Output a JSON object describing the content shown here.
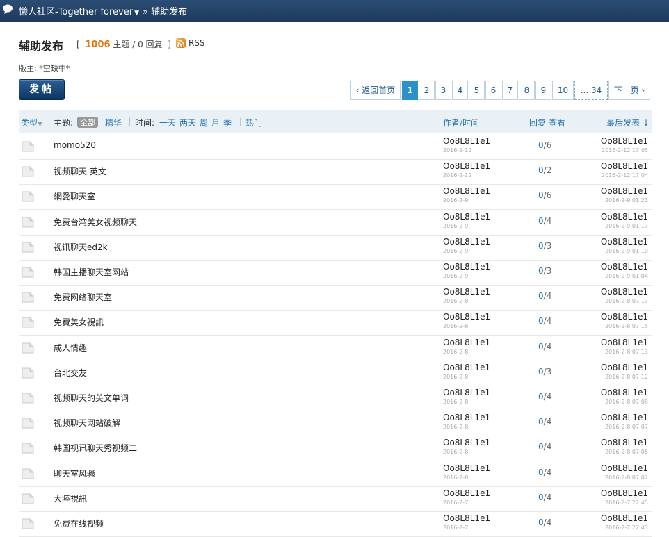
{
  "header": {
    "site_name": "懒人社区-Together forever",
    "breadcrumb": "» 辅助发布"
  },
  "forum": {
    "title": "辅助发布",
    "stats_open": "[",
    "topic_count": "1006",
    "topic_label": "主题",
    "sep": "/",
    "reply_count": "0",
    "reply_label": "回复",
    "stats_close": "]",
    "rss_label": "RSS",
    "moderator": "版主: *空缺中*"
  },
  "toolbar": {
    "post_label": "发帖"
  },
  "pager": {
    "back_label": "‹ 返回首页",
    "pages": [
      "1",
      "2",
      "3",
      "4",
      "5",
      "6",
      "7",
      "8",
      "9",
      "10"
    ],
    "current": "1",
    "last_label": "... 34",
    "next_label": "下一页 ›"
  },
  "thead": {
    "type_label": "类型",
    "topic_label": "主题:",
    "all_label": "全部",
    "digest_label": "精华",
    "time_label": "时间:",
    "day1": "一天",
    "day2": "两天",
    "week": "周",
    "month": "月",
    "season": "季",
    "hot_label": "热门",
    "author_label": "作者/时间",
    "reply_view_label": "回复 查看",
    "lastpost_label": "最后发表 ↓"
  },
  "threads": [
    {
      "title": "momo520",
      "author": "Oo8L8L1e1",
      "date": "2016-2-12",
      "replies": "0",
      "views": "6",
      "last_by": "Oo8L8L1e1",
      "last_time": "2016-2-12 17:05"
    },
    {
      "title": "视频聊天 英文",
      "author": "Oo8L8L1e1",
      "date": "2016-2-12",
      "replies": "0",
      "views": "2",
      "last_by": "Oo8L8L1e1",
      "last_time": "2016-2-12 17:04"
    },
    {
      "title": "網愛聊天室",
      "author": "Oo8L8L1e1",
      "date": "2016-2-9",
      "replies": "0",
      "views": "6",
      "last_by": "Oo8L8L1e1",
      "last_time": "2016-2-9 01:23"
    },
    {
      "title": "免费台湾美女视频聊天",
      "author": "Oo8L8L1e1",
      "date": "2016-2-9",
      "replies": "0",
      "views": "4",
      "last_by": "Oo8L8L1e1",
      "last_time": "2016-2-9 01:17"
    },
    {
      "title": "视讯聊天ed2k",
      "author": "Oo8L8L1e1",
      "date": "2016-2-9",
      "replies": "0",
      "views": "3",
      "last_by": "Oo8L8L1e1",
      "last_time": "2016-2-9 01:10"
    },
    {
      "title": "韩国主播聊天室网站",
      "author": "Oo8L8L1e1",
      "date": "2016-2-9",
      "replies": "0",
      "views": "3",
      "last_by": "Oo8L8L1e1",
      "last_time": "2016-2-9 01:04"
    },
    {
      "title": "免费网络聊天室",
      "author": "Oo8L8L1e1",
      "date": "2016-2-8",
      "replies": "0",
      "views": "4",
      "last_by": "Oo8L8L1e1",
      "last_time": "2016-2-8 07:17"
    },
    {
      "title": "免費美女視訊",
      "author": "Oo8L8L1e1",
      "date": "2016-2-8",
      "replies": "0",
      "views": "4",
      "last_by": "Oo8L8L1e1",
      "last_time": "2016-2-8 07:15"
    },
    {
      "title": "成人情趣",
      "author": "Oo8L8L1e1",
      "date": "2016-2-8",
      "replies": "0",
      "views": "4",
      "last_by": "Oo8L8L1e1",
      "last_time": "2016-2-8 07:13"
    },
    {
      "title": "台北交友",
      "author": "Oo8L8L1e1",
      "date": "2016-2-8",
      "replies": "0",
      "views": "3",
      "last_by": "Oo8L8L1e1",
      "last_time": "2016-2-8 07:12"
    },
    {
      "title": "视频聊天的英文单词",
      "author": "Oo8L8L1e1",
      "date": "2016-2-8",
      "replies": "0",
      "views": "4",
      "last_by": "Oo8L8L1e1",
      "last_time": "2016-2-8 07:08"
    },
    {
      "title": "视频聊天网站破解",
      "author": "Oo8L8L1e1",
      "date": "2016-2-8",
      "replies": "0",
      "views": "4",
      "last_by": "Oo8L8L1e1",
      "last_time": "2016-2-8 07:07"
    },
    {
      "title": "韩国视讯聊天秀视频二",
      "author": "Oo8L8L1e1",
      "date": "2016-2-8",
      "replies": "0",
      "views": "4",
      "last_by": "Oo8L8L1e1",
      "last_time": "2016-2-8 07:05"
    },
    {
      "title": "聊天室风骚",
      "author": "Oo8L8L1e1",
      "date": "2016-2-8",
      "replies": "0",
      "views": "4",
      "last_by": "Oo8L8L1e1",
      "last_time": "2016-2-8 07:02"
    },
    {
      "title": "大陸視訊",
      "author": "Oo8L8L1e1",
      "date": "2016-2-7",
      "replies": "0",
      "views": "4",
      "last_by": "Oo8L8L1e1",
      "last_time": "2016-2-7 22:45"
    },
    {
      "title": "免费在线视频",
      "author": "Oo8L8L1e1",
      "date": "2016-2-7",
      "replies": "0",
      "views": "4",
      "last_by": "Oo8L8L1e1",
      "last_time": "2016-2-7 22:43"
    }
  ]
}
